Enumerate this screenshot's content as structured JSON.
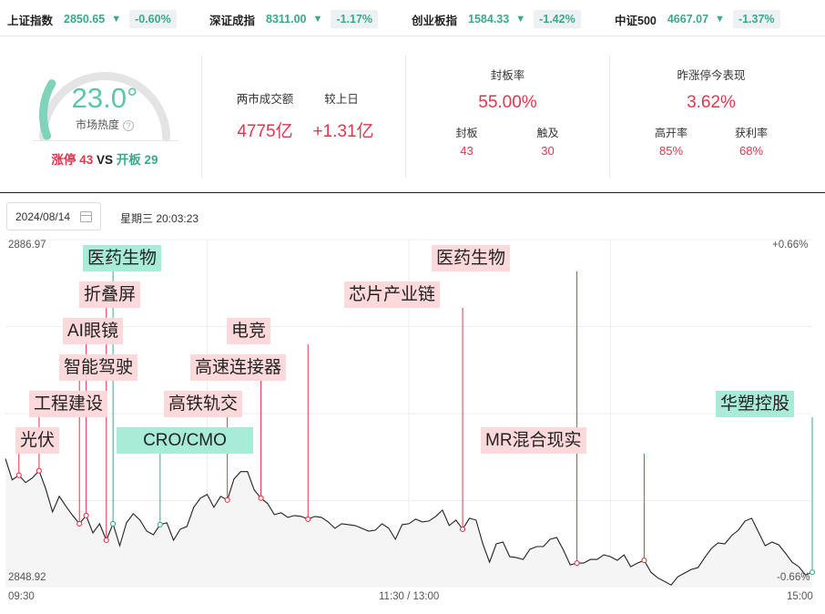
{
  "indices": [
    {
      "name": "上证指数",
      "value": "2850.65",
      "arrow": "▼",
      "change": "-0.60%"
    },
    {
      "name": "深证成指",
      "value": "8311.00",
      "arrow": "▼",
      "change": "-1.17%"
    },
    {
      "name": "创业板指",
      "value": "1584.33",
      "arrow": "▼",
      "change": "-1.42%"
    },
    {
      "name": "中证500",
      "value": "4667.07",
      "arrow": "▼",
      "change": "-1.37%"
    }
  ],
  "heat": {
    "value": "23.0°",
    "level": 0.23,
    "label": "市场热度",
    "help_glyph": "?",
    "limit_up_label": "涨停",
    "limit_up_count": "43",
    "vs": "VS",
    "broken_label": "开板",
    "broken_count": "29"
  },
  "turnover": {
    "label": "两市成交额",
    "value": "4775亿",
    "compare_label": "较上日",
    "compare_value": "+1.31亿"
  },
  "seal": {
    "title": "封板率",
    "value": "55.00%",
    "sealed_label": "封板",
    "sealed_value": "43",
    "touched_label": "触及",
    "touched_value": "30"
  },
  "yesterday": {
    "title": "昨涨停今表现",
    "value": "3.62%",
    "open_high_label": "高开率",
    "open_high_value": "85%",
    "profit_label": "获利率",
    "profit_value": "68%"
  },
  "date": {
    "value": "2024/08/14",
    "weekday_time": "星期三 20:03:23"
  },
  "chart_data": {
    "type": "line",
    "title": "",
    "y_max_label": "2886.97",
    "y_min_label": "2848.92",
    "ylim": [
      2848.92,
      2886.97
    ],
    "pct_max_label": "+0.66%",
    "pct_min_label": "-0.66%",
    "x_labels": [
      "09:30",
      "11:30 / 13:00",
      "15:00"
    ],
    "prev_close": 2867.945,
    "series": [
      {
        "x": [
          0,
          2,
          4,
          6,
          8,
          10,
          12,
          14,
          16,
          18,
          20,
          22,
          24,
          26,
          28,
          30,
          32,
          34,
          36,
          38,
          40,
          42,
          44,
          46,
          48,
          50,
          52,
          54,
          56,
          58,
          60,
          62,
          64,
          66,
          68,
          70,
          72,
          74,
          76,
          78,
          80,
          82,
          84,
          86,
          88,
          90,
          92,
          94,
          96,
          98,
          100,
          102,
          104,
          106,
          108,
          110,
          112,
          114,
          116,
          118,
          120,
          122,
          124,
          126,
          128,
          130,
          132,
          134,
          136,
          138,
          140,
          142,
          144,
          146,
          148,
          150,
          152,
          154,
          156,
          158,
          160,
          162,
          164,
          166,
          168,
          170,
          172,
          174,
          176,
          178,
          180,
          182,
          184,
          186,
          188,
          190,
          192,
          194,
          196,
          198,
          200,
          202,
          204,
          206,
          208,
          210,
          212,
          214,
          216,
          218,
          220,
          222,
          224,
          226,
          228,
          230,
          232,
          234,
          236,
          238,
          240
        ],
        "y": [
          2863.0,
          2860.7,
          2861.2,
          2860.4,
          2860.9,
          2861.7,
          2859.7,
          2857.2,
          2858.9,
          2857.8,
          2856.8,
          2855.9,
          2856.8,
          2854.9,
          2855.9,
          2854.1,
          2855.9,
          2853.5,
          2856.0,
          2857.0,
          2856.3,
          2855.1,
          2854.7,
          2855.8,
          2856.0,
          2854.1,
          2855.3,
          2855.6,
          2857.7,
          2858.7,
          2859.1,
          2857.7,
          2858.9,
          2858.5,
          2860.8,
          2861.6,
          2861.6,
          2859.6,
          2858.7,
          2858.1,
          2856.9,
          2857.1,
          2856.6,
          2856.8,
          2856.7,
          2856.4,
          2856.7,
          2856.6,
          2856.1,
          2855.4,
          2855.9,
          2855.8,
          2855.7,
          2855.4,
          2855.1,
          2855.2,
          2855.9,
          2855.4,
          2854.2,
          2855.8,
          2855.9,
          2856.4,
          2856.1,
          2856.2,
          2856.7,
          2857.4,
          2855.7,
          2856.3,
          2855.3,
          2856.5,
          2856.3,
          2853.7,
          2851.7,
          2853.7,
          2853.9,
          2852.3,
          2852.2,
          2852.0,
          2853.1,
          2853.4,
          2853.4,
          2854.2,
          2854.4,
          2853.0,
          2851.4,
          2851.6,
          2851.6,
          2852.0,
          2852.0,
          2852.5,
          2852.3,
          2851.9,
          2852.5,
          2851.2,
          2851.6,
          2851.9,
          2850.6,
          2850.0,
          2849.6,
          2849.2,
          2850.1,
          2850.5,
          2850.9,
          2851.1,
          2852.2,
          2853.2,
          2853.8,
          2853.7,
          2854.6,
          2855.2,
          2856.2,
          2856.5,
          2855.0,
          2853.5,
          2853.9,
          2853.6,
          2852.7,
          2851.7,
          2851.2,
          2850.3,
          2850.6
        ]
      }
    ],
    "events": [
      {
        "label": "光伏",
        "color": "pink"
      },
      {
        "label": "工程建设",
        "color": "pink"
      },
      {
        "label": "智能驾驶",
        "color": "pink"
      },
      {
        "label": "AI眼镜",
        "color": "pink"
      },
      {
        "label": "折叠屏",
        "color": "pink"
      },
      {
        "label": "医药生物",
        "color": "mint"
      },
      {
        "label": "CRO/CMO",
        "color": "mint"
      },
      {
        "label": "高铁轨交",
        "color": "pink"
      },
      {
        "label": "高速连接器",
        "color": "pink"
      },
      {
        "label": "电竞",
        "color": "pink"
      },
      {
        "label": "芯片产业链",
        "color": "pink"
      },
      {
        "label": "医药生物",
        "color": "pink"
      },
      {
        "label": "MR混合现实",
        "color": "pink"
      },
      {
        "label": "华塑控股",
        "color": "mint"
      }
    ]
  },
  "colors": {
    "up": "#e0364e",
    "down": "#3aa98b",
    "gauge_track": "#e4e4e4",
    "gauge_fill": "#7fd3b8",
    "line": "#222222",
    "tag_pink": "#fdd9dc",
    "tag_mint": "#a8ebd6"
  }
}
